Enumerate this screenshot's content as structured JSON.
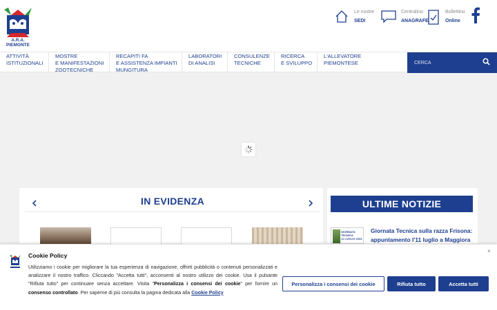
{
  "colors": {
    "brand": "#1e3f8f",
    "background": "#f1f1f1",
    "white": "#ffffff"
  },
  "logo": {
    "text_line1": "A.R.A.",
    "text_line2": "PIEMONTE"
  },
  "header": {
    "sedi": {
      "top": "Le nostre",
      "bottom": "SEDI",
      "icon": "home-icon"
    },
    "anagrafe": {
      "top": "Centralino",
      "bottom": "ANAGRAFE",
      "icon": "chat-icon"
    },
    "bollettino": {
      "top": "Bollettino",
      "bottom": "Online",
      "icon": "document-check-icon"
    },
    "social": {
      "icon": "facebook-icon"
    }
  },
  "nav": {
    "items": [
      {
        "line1": "ATTIVITÀ",
        "line2": "ISTITUZIONALI",
        "line3": ""
      },
      {
        "line1": "MOSTRE",
        "line2": "E MANIFESTAZIONI",
        "line3": "ZOOTECNICHE"
      },
      {
        "line1": "RECAPITI FA",
        "line2": "E ASSISTENZA IMPIANTI",
        "line3": "MUNGITURA"
      },
      {
        "line1": "LABORATORI",
        "line2": "DI ANALISI",
        "line3": ""
      },
      {
        "line1": "CONSULENZE",
        "line2": "TECNICHE",
        "line3": ""
      },
      {
        "line1": "RICERCA",
        "line2": "E SVILUPPO",
        "line3": ""
      },
      {
        "line1": "L'ALLEVATORE",
        "line2": "PIEMONTESE",
        "line3": ""
      }
    ],
    "search_placeholder": "CERCA"
  },
  "evidenza": {
    "title": "IN EVIDENZA"
  },
  "news": {
    "title": "ULTIME NOTIZIE",
    "item_title": "Giornata Tecnica sulla razza Frisona: appuntamento l'11 luglio a Maggiora",
    "thumb_line1": "GIORNATA",
    "thumb_line2": "TECNICA",
    "thumb_line3": "11 LUGLIO 2024"
  },
  "cookie": {
    "title": "Cookie Policy",
    "text_part1": "Utilizziamo i cookie per migliorare la tua esperienza di navigazione, offrirti pubblicità o contenuti personalizzati e analizzare il nostro traffico. Cliccando \"Accetta tutti\", acconsenti al nostro utilizzo dei cookie. Usa il pulsante \"Rifiuta tutto\" per continuare senza accettare. Visita \"",
    "text_bold1": "Personalizza i consensi dei cookie",
    "text_part2": "\" per fornire un ",
    "text_bold2": "consenso controllato",
    "text_part3": ". Per saperne di più consulta la pagina dedicata alla ",
    "link": "Cookie Policy",
    "btn_customize": "Personalizza i consensi dei cookie",
    "btn_reject": "Rifiuta tutto",
    "btn_accept": "Accetta tutti",
    "close": "×"
  }
}
